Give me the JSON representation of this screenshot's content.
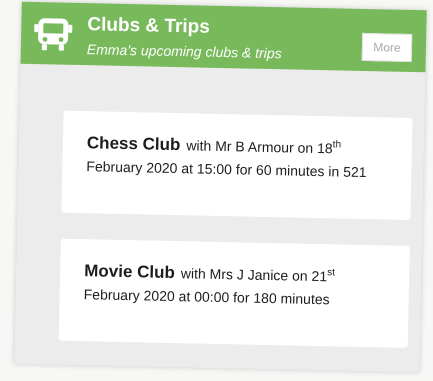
{
  "header": {
    "title": "Clubs & Trips",
    "subtitle": "Emma's upcoming clubs & trips",
    "icon": "bus-icon",
    "more_label": "More",
    "color": "#78b95b"
  },
  "items": [
    {
      "name": "Chess Club",
      "detail": "with Mr B Armour on 18",
      "suffix": "th",
      "line2": "February 2020 at 15:00 for 60 minutes in 521"
    },
    {
      "name": "Movie Club",
      "detail": "with Mrs J Janice on 21",
      "suffix": "st",
      "line2": "February 2020 at 00:00 for 180 minutes"
    }
  ]
}
